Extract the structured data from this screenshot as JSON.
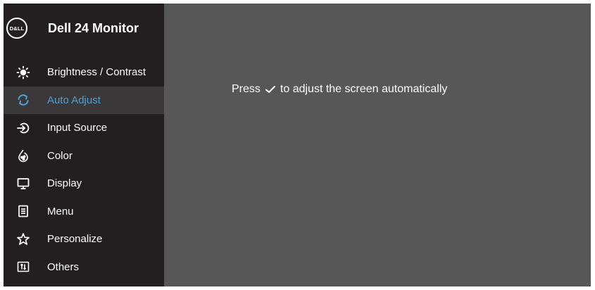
{
  "header": {
    "logo_text": "D&LL",
    "title": "Dell 24 Monitor"
  },
  "menu": {
    "items": [
      {
        "label": "Brightness / Contrast",
        "icon": "brightness-icon"
      },
      {
        "label": "Auto Adjust",
        "icon": "auto-adjust-icon",
        "selected": true
      },
      {
        "label": "Input Source",
        "icon": "input-source-icon"
      },
      {
        "label": "Color",
        "icon": "color-icon"
      },
      {
        "label": "Display",
        "icon": "display-icon"
      },
      {
        "label": "Menu",
        "icon": "menu-icon"
      },
      {
        "label": "Personalize",
        "icon": "personalize-icon"
      },
      {
        "label": "Others",
        "icon": "others-icon"
      }
    ]
  },
  "content": {
    "message_before": "Press",
    "message_icon": "checkmark-icon",
    "message_after": "to adjust the screen automatically"
  },
  "colors": {
    "sidebar_bg": "#231f20",
    "content_bg": "#575757",
    "selected_bg": "#3a3839",
    "accent": "#4d9fd6",
    "text": "#ffffff"
  }
}
